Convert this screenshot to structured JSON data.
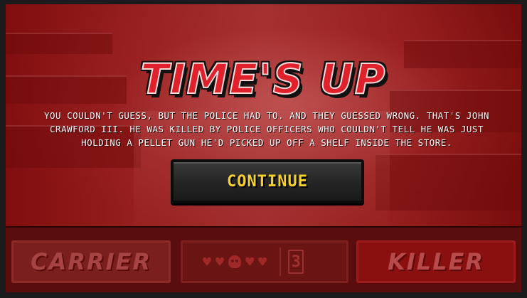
{
  "overlay": {
    "title": "TIME'S UP",
    "message": "YOU COULDN'T GUESS, BUT THE POLICE HAD TO. AND THEY GUESSED WRONG. THAT'S JOHN CRAWFORD III. HE WAS KILLED BY POLICE OFFICERS WHO COULDN'T TELL HE WAS JUST HOLDING A PELLET GUN HE'D PICKED UP OFF A SHELF INSIDE THE STORE.",
    "continue_label": "CONTINUE"
  },
  "bottom_bar": {
    "left_choice": "CARRIER",
    "right_choice": "KILLER",
    "lives": [
      {
        "icon": "heart-icon",
        "glyph": "♥"
      },
      {
        "icon": "heart-icon",
        "glyph": "♥"
      },
      {
        "icon": "skull-icon",
        "glyph": ""
      },
      {
        "icon": "heart-icon",
        "glyph": "♥"
      },
      {
        "icon": "heart-icon",
        "glyph": "♥"
      }
    ],
    "round_number": "3"
  },
  "colors": {
    "title_red": "#e0202a",
    "continue_text": "#f6d02a",
    "overlay_tint": "#8a1a1a"
  }
}
